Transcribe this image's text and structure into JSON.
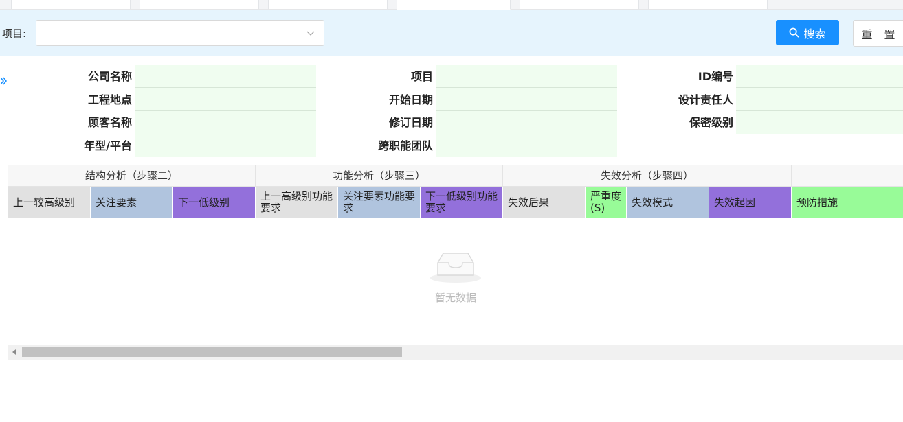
{
  "search": {
    "project_label": "项目:",
    "project_value": "",
    "search_button": "搜索",
    "reset_button": "重 置"
  },
  "info": {
    "col1": [
      {
        "label": "公司名称",
        "value": ""
      },
      {
        "label": "工程地点",
        "value": ""
      },
      {
        "label": "顾客名称",
        "value": ""
      },
      {
        "label": "年型/平台",
        "value": ""
      }
    ],
    "col2": [
      {
        "label": "项目",
        "value": ""
      },
      {
        "label": "开始日期",
        "value": ""
      },
      {
        "label": "修订日期",
        "value": ""
      },
      {
        "label": "跨职能团队",
        "value": ""
      }
    ],
    "col3": [
      {
        "label": "ID编号",
        "value": ""
      },
      {
        "label": "设计责任人",
        "value": ""
      },
      {
        "label": "保密级别",
        "value": ""
      }
    ]
  },
  "table": {
    "groups": [
      "结构分析（步骤二）",
      "功能分析（步骤三）",
      "失效分析（步骤四）",
      ""
    ],
    "columns": [
      "上一较高级别",
      "关注要素",
      "下一低级别",
      "上一高级别功能要求",
      "关注要素功能要求",
      "下一低级别功能要求",
      "失效后果",
      "严重度(S)",
      "失效模式",
      "失效起因",
      "预防措施"
    ],
    "empty_text": "暂无数据"
  },
  "colors": {
    "accent": "#1890ff",
    "search_bg": "#e6f4fd",
    "info_value_bg": "#f0fdf0",
    "col_gray": "#e1e1e1",
    "col_blue": "#b0c4de",
    "col_purple": "#9370db",
    "col_green": "#98fb98"
  }
}
